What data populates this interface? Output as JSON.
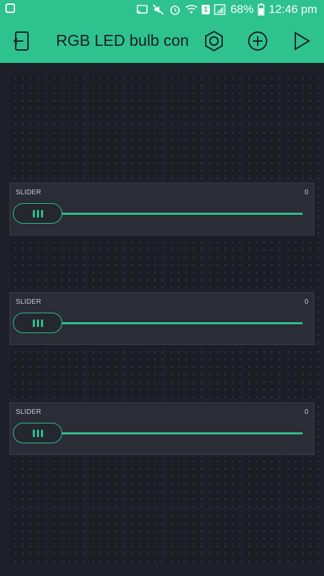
{
  "status_bar": {
    "battery_percent": "68%",
    "time": "12:46 pm",
    "sim_badge": "1"
  },
  "app_bar": {
    "title": "RGB LED bulb contrc"
  },
  "sliders": [
    {
      "label": "SLIDER",
      "value": "0",
      "level": 0.0
    },
    {
      "label": "SLIDER",
      "value": "0",
      "level": 0.0
    },
    {
      "label": "SLIDER",
      "value": "0",
      "level": 0.0
    }
  ],
  "colors": {
    "accent": "#2ec28e",
    "background": "#1e2129",
    "widget": "#2a2d35"
  }
}
